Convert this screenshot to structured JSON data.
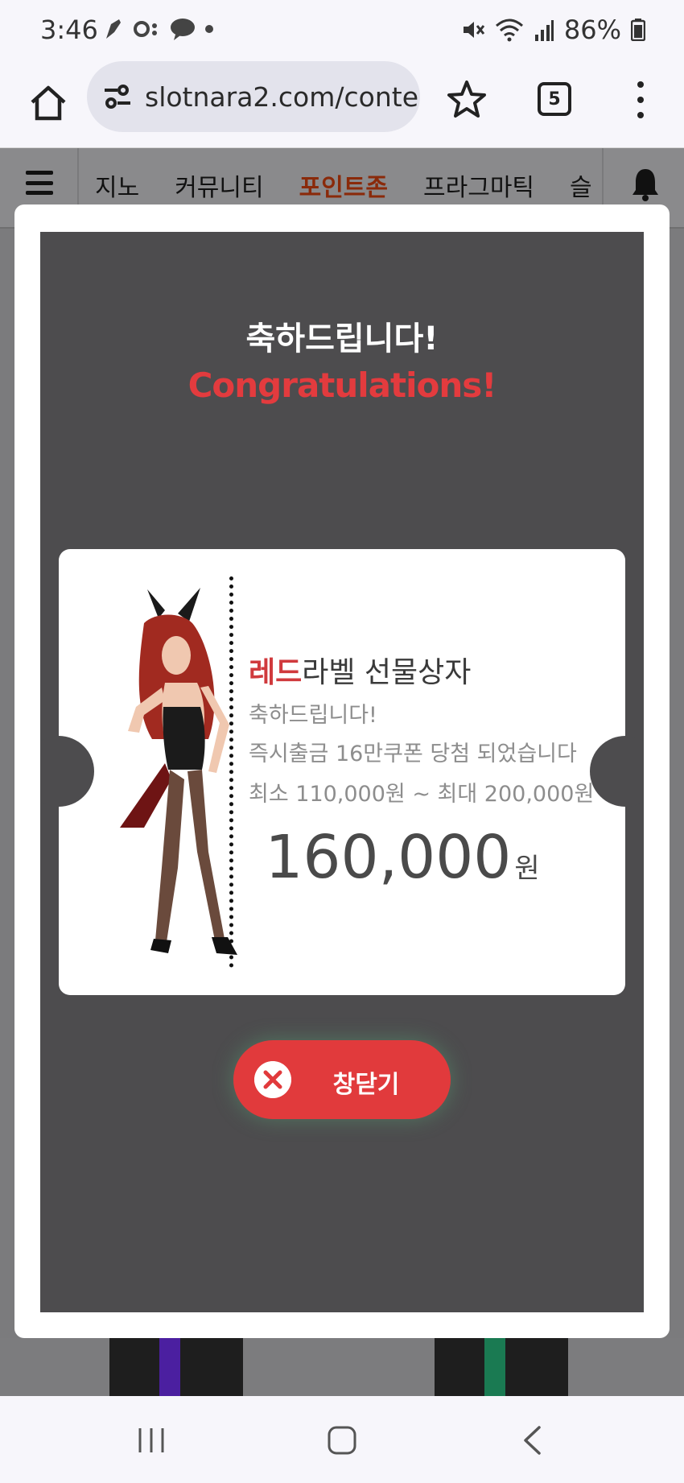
{
  "status_bar": {
    "time": "3:46",
    "battery": "86%"
  },
  "browser": {
    "url": "slotnara2.com/conte",
    "tab_count": "5"
  },
  "site_nav": {
    "items": [
      {
        "label": "지노"
      },
      {
        "label": "커뮤니티"
      },
      {
        "label": "포인트존",
        "active": true
      },
      {
        "label": "프라그마틱"
      },
      {
        "label": "슬"
      }
    ]
  },
  "modal": {
    "title_ko": "축하드립니다!",
    "title_en": "Congratulations!",
    "coupon": {
      "title_highlight": "레드",
      "title_rest": "라벨 선물상자",
      "line1": "축하드립니다!",
      "line2": "즉시출금 16만쿠폰 당첨 되었습니다",
      "line3": "최소 110,000원 ~ 최대 200,000원",
      "amount": "160,000",
      "unit": "원"
    },
    "close_label": "창닫기"
  },
  "colors": {
    "accent_red": "#e13a3c",
    "modal_bg": "#4d4c4e",
    "nav_active": "#8a2a0a"
  }
}
